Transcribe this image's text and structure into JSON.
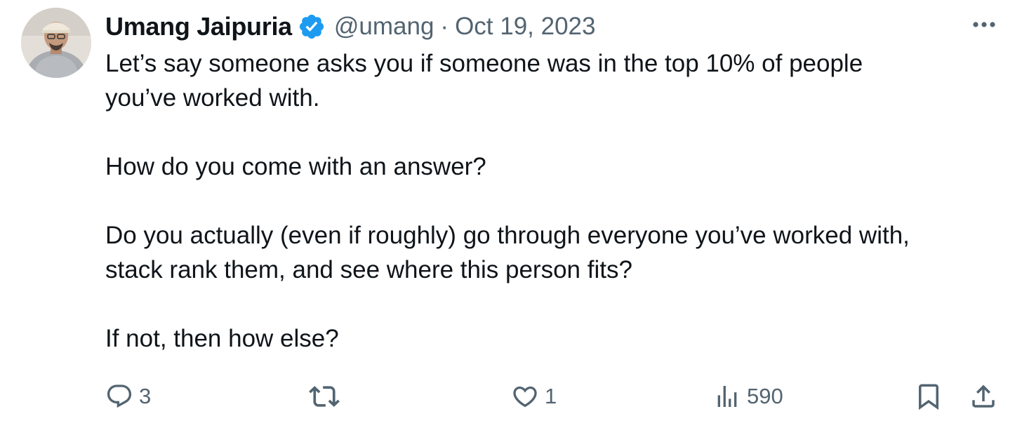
{
  "author": {
    "display_name": "Umang Jaipuria",
    "handle": "@umang",
    "separator": "·",
    "date": "Oct 19, 2023",
    "verified": true,
    "avatar_icon": "avatar-photo"
  },
  "tweet": {
    "paragraphs": [
      "Let’s say someone asks you if someone was in the top 10% of people\nyou’ve worked with.",
      "How do you come with an answer?",
      "Do you actually (even if roughly) go through everyone you’ve worked with,\nstack rank them, and see where this person fits?",
      "If not, then how else?"
    ]
  },
  "actions": {
    "reply": {
      "icon": "reply-icon",
      "count": "3"
    },
    "retweet": {
      "icon": "retweet-icon",
      "count": ""
    },
    "like": {
      "icon": "heart-icon",
      "count": "1"
    },
    "views": {
      "icon": "views-icon",
      "count": "590"
    },
    "bookmark": {
      "icon": "bookmark-icon"
    },
    "share": {
      "icon": "share-icon"
    }
  },
  "colors": {
    "text_primary": "#0f1419",
    "text_secondary": "#536471",
    "verified_blue": "#1d9bf0"
  }
}
